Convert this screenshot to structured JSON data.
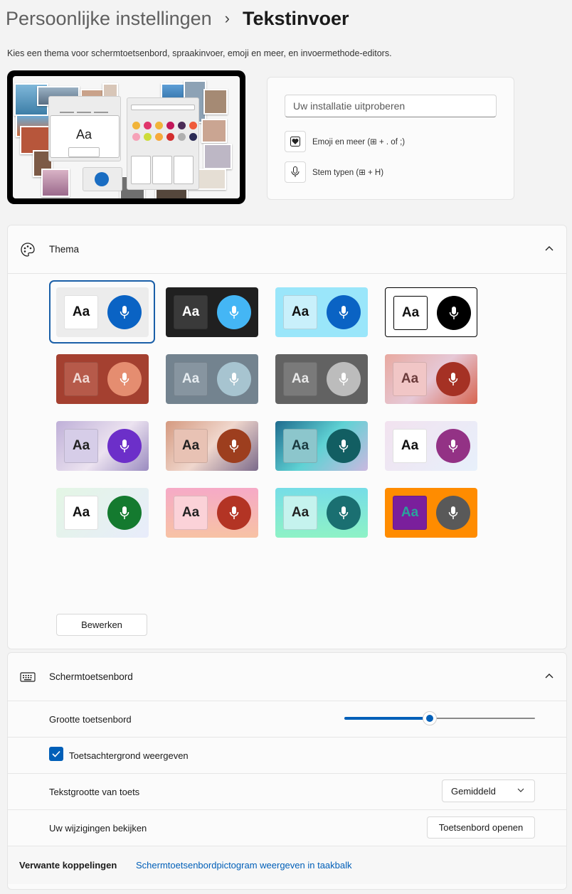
{
  "breadcrumb": {
    "parent": "Persoonlijke instellingen",
    "separator": "›",
    "current": "Tekstinvoer"
  },
  "description": "Kies een thema voor schermtoetsenbord, spraakinvoer, emoji en meer, en invoermethode-editors.",
  "preview": {
    "aa": "Aa"
  },
  "try_card": {
    "input_placeholder": "Uw installatie uitproberen",
    "emoji_label": "Emoji en meer (⊞ + . of ;)",
    "voice_label": "Stem typen (⊞ + H)"
  },
  "theme_section": {
    "title": "Thema",
    "aa_text": "Aa",
    "edit_button": "Bewerken",
    "themes": [
      {
        "aa_bg": "#ffffff",
        "aa_fg": "#111111",
        "mic_bg": "#0a63c4",
        "tile_bg": "#ececec",
        "selected": true
      },
      {
        "aa_bg": "#3a3a3a",
        "aa_fg": "#ffffff",
        "mic_bg": "#44b6f5",
        "tile_bg": "#202020"
      },
      {
        "aa_bg": "#c9f0fb",
        "aa_fg": "#111111",
        "mic_bg": "#0a63c4",
        "tile_bg": "#9ae6fa"
      },
      {
        "aa_bg": "#ffffff",
        "aa_fg": "#111111",
        "mic_bg": "#000000",
        "tile_bg": "#ffffff",
        "border": "#000000"
      },
      {
        "aa_bg": "#b65a4a",
        "aa_fg": "#f1d9d4",
        "mic_bg": "#e58d70",
        "tile_bg": "#a44030"
      },
      {
        "aa_bg": "#8795a0",
        "aa_fg": "#e6ecf0",
        "mic_bg": "#a7c4d0",
        "tile_bg": "#73838f"
      },
      {
        "aa_bg": "#7a7a7a",
        "aa_fg": "#e8e8e8",
        "mic_bg": "#bcbcbc",
        "tile_bg": "#626262"
      },
      {
        "aa_bg": "#f1c6c6",
        "aa_fg": "#6b3b3b",
        "mic_bg": "#a53124",
        "tile_bg": "linear-gradient(135deg,#e8a9a0,#e6c8d6 50%,#d76450)"
      },
      {
        "aa_bg": "#d6cde8",
        "aa_fg": "#222222",
        "mic_bg": "#6c2fc9",
        "tile_bg": "linear-gradient(135deg,#bfb0d8,#ece3f0 55%,#9a8bc0)"
      },
      {
        "aa_bg": "#e8c2b4",
        "aa_fg": "#222222",
        "mic_bg": "#9d3e1e",
        "tile_bg": "linear-gradient(135deg,#d59a80,#f0d7cd 50%,#7b6a8a)"
      },
      {
        "aa_bg": "#8cc6cc",
        "aa_fg": "#1b3a40",
        "mic_bg": "#125e62",
        "tile_bg": "linear-gradient(135deg,#1f6c8e,#5fd2d4 50%,#cbb8e0)"
      },
      {
        "aa_bg": "#ffffff",
        "aa_fg": "#111111",
        "mic_bg": "#933285",
        "tile_bg": "linear-gradient(135deg,#f2e2ef,#e7f0fb)"
      },
      {
        "aa_bg": "#ffffff",
        "aa_fg": "#111111",
        "mic_bg": "#147a2f",
        "tile_bg": "linear-gradient(135deg,#e3f6e4,#e8ecfb)"
      },
      {
        "aa_bg": "#fbd2d8",
        "aa_fg": "#222222",
        "mic_bg": "#b33424",
        "tile_bg": "linear-gradient(180deg,#f6aac7,#f7c2a4)"
      },
      {
        "aa_bg": "#c5f3ee",
        "aa_fg": "#222222",
        "mic_bg": "#1a6f71",
        "tile_bg": "linear-gradient(180deg,#76dde7,#8ef2c6)"
      },
      {
        "aa_bg": "#7a1f9c",
        "aa_fg": "#2aa39c",
        "mic_bg": "#595959",
        "tile_bg": "#ff8c00"
      }
    ]
  },
  "keyboard_section": {
    "title": "Schermtoetsenbord",
    "size_label": "Grootte toetsenbord",
    "size_value": 0.44,
    "background_label": "Toetsachtergrond weergeven",
    "background_checked": true,
    "text_size_label": "Tekstgrootte van toets",
    "text_size_value": "Gemiddeld",
    "review_label": "Uw wijzigingen bekijken",
    "open_button": "Toetsenbord openen"
  },
  "related": {
    "label": "Verwante koppelingen",
    "link": "Schermtoetsenbordpictogram weergeven in taakbalk"
  },
  "colors": {
    "accent": "#005fb8"
  }
}
